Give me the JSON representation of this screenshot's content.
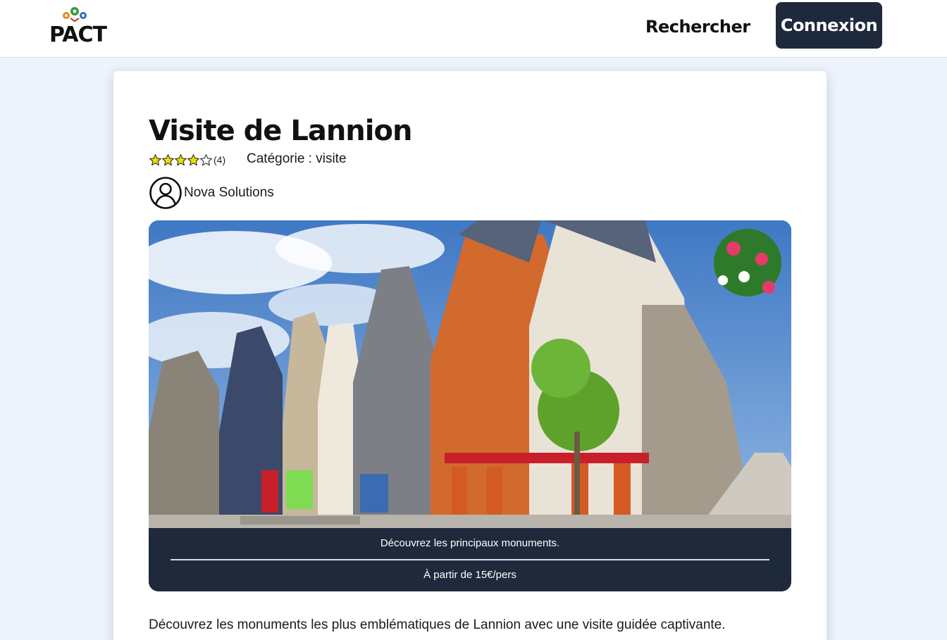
{
  "header": {
    "logo_text": "PACT",
    "nav_search": "Rechercher",
    "nav_login": "Connexion"
  },
  "offer": {
    "title": "Visite de Lannion",
    "rating": {
      "stars_filled": 4,
      "stars_total": 5,
      "count_label": "(4)"
    },
    "category_label": "Catégorie :",
    "category_value": "visite",
    "provider": "Nova Solutions",
    "image_caption": "Découvrez les principaux monuments.",
    "price": "À partir de 15€/pers",
    "description": "Découvrez les monuments les plus emblématiques de Lannion avec une visite guidée captivante."
  },
  "colors": {
    "accent_dark": "#1e293b",
    "page_background": "#eef3fc",
    "star_fill": "#e8e000"
  },
  "icons": {
    "logo_pins": "map-pin-icons",
    "avatar": "user-circle-icon",
    "star": "star-icon"
  }
}
